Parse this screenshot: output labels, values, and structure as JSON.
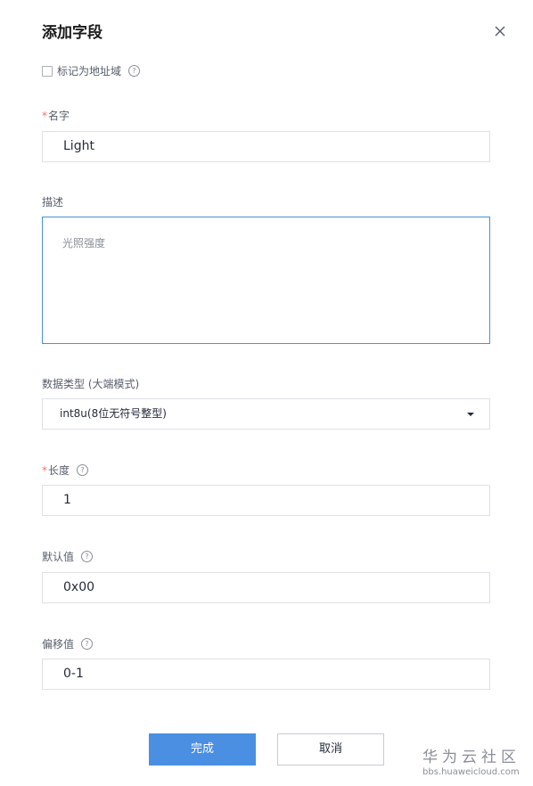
{
  "dialog": {
    "title": "添加字段",
    "close_icon": "close-icon"
  },
  "address_field_checkbox": {
    "label": "标记为地址域",
    "checked": false,
    "help_icon": "question-circle-icon",
    "help_glyph": "?"
  },
  "name": {
    "required_mark": "*",
    "label": "名字",
    "value": "Light"
  },
  "description": {
    "label": "描述",
    "value": "光照强度"
  },
  "data_type": {
    "label": "数据类型 (大端模式)",
    "selected": "int8u(8位无符号整型)",
    "caret_icon": "caret-down-icon"
  },
  "length": {
    "required_mark": "*",
    "label": "长度",
    "help_icon": "question-circle-icon",
    "help_glyph": "?",
    "value": "1"
  },
  "default_value": {
    "label": "默认值",
    "help_icon": "question-circle-icon",
    "help_glyph": "?",
    "value": "0x00"
  },
  "offset": {
    "label": "偏移值",
    "help_icon": "question-circle-icon",
    "help_glyph": "?",
    "value": "0-1"
  },
  "actions": {
    "confirm_label": "完成",
    "cancel_label": "取消"
  },
  "watermark": {
    "title": "华为云社区",
    "url": "bbs.huaweicloud.com"
  },
  "colors": {
    "primary": "#4a8fe2",
    "required": "#f66f6a",
    "focus_border": "#4a90d9"
  }
}
